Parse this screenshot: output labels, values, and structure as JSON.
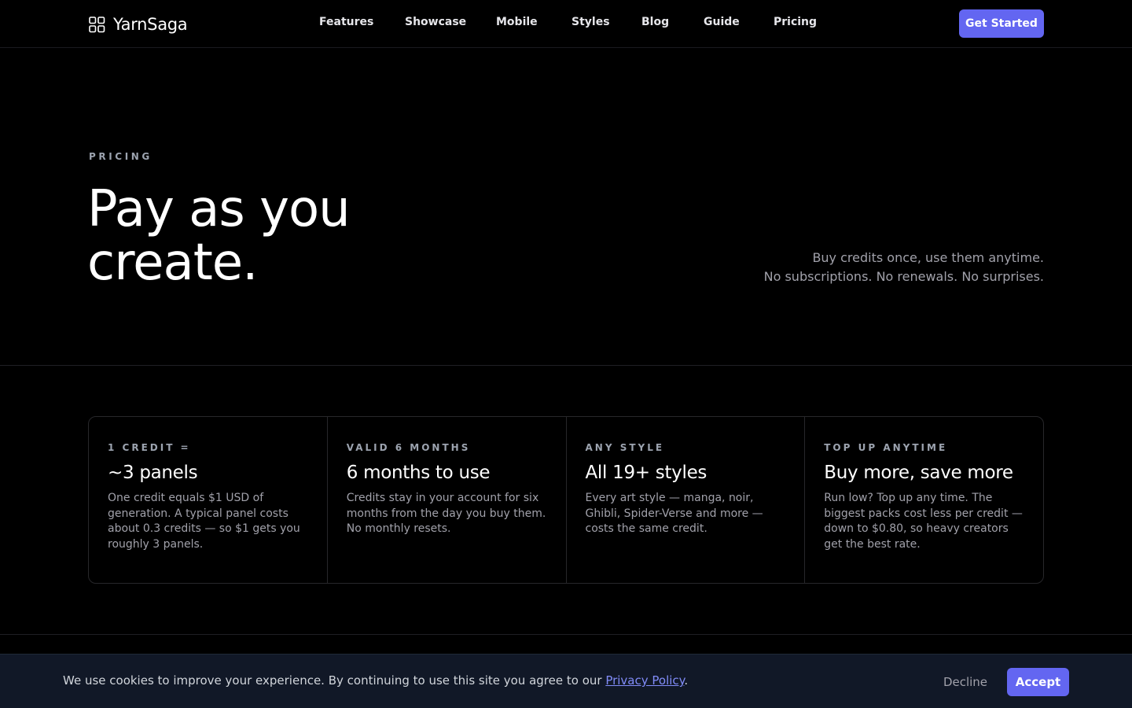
{
  "brand": {
    "name": "YarnSaga",
    "icon": "grid-logo-icon"
  },
  "nav": {
    "links": [
      {
        "label": "Features"
      },
      {
        "label": "Showcase"
      },
      {
        "label": "Mobile"
      },
      {
        "label": "Styles"
      },
      {
        "label": "Blog"
      },
      {
        "label": "Guide"
      },
      {
        "label": "Pricing"
      }
    ],
    "cta_label": "Get Started"
  },
  "hero": {
    "eyebrow": "PRICING",
    "title_line1": "Pay as you",
    "title_line2": "create.",
    "subtitle_line1": "Buy credits once, use them anytime.",
    "subtitle_line2": "No subscriptions. No renewals. No surprises."
  },
  "features": [
    {
      "label": "1 CREDIT =",
      "title": "~3 panels",
      "body": "One credit equals $1 USD of generation. A typical panel costs about 0.3 credits — so $1 gets you roughly 3 panels."
    },
    {
      "label": "VALID 6 MONTHS",
      "title": "6 months to use",
      "body": "Credits stay in your account for six months from the day you buy them. No monthly resets."
    },
    {
      "label": "ANY STYLE",
      "title": "All 19+ styles",
      "body": "Every art style — manga, noir, Ghibli, Spider-Verse and more — costs the same credit."
    },
    {
      "label": "TOP UP ANYTIME",
      "title": "Buy more, save more",
      "body": "Run low? Top up any time. The biggest packs cost less per credit — down to $0.80, so heavy creators get the best rate."
    }
  ],
  "cookie": {
    "text_before": "We use cookies to improve your experience. By continuing to use this site you agree to our ",
    "link_label": "Privacy Policy",
    "text_after": ".",
    "decline_label": "Decline",
    "accept_label": "Accept"
  },
  "colors": {
    "accent": "#6366f1",
    "background": "#000000",
    "cookie_bar": "#111827",
    "link": "#818cf8"
  }
}
